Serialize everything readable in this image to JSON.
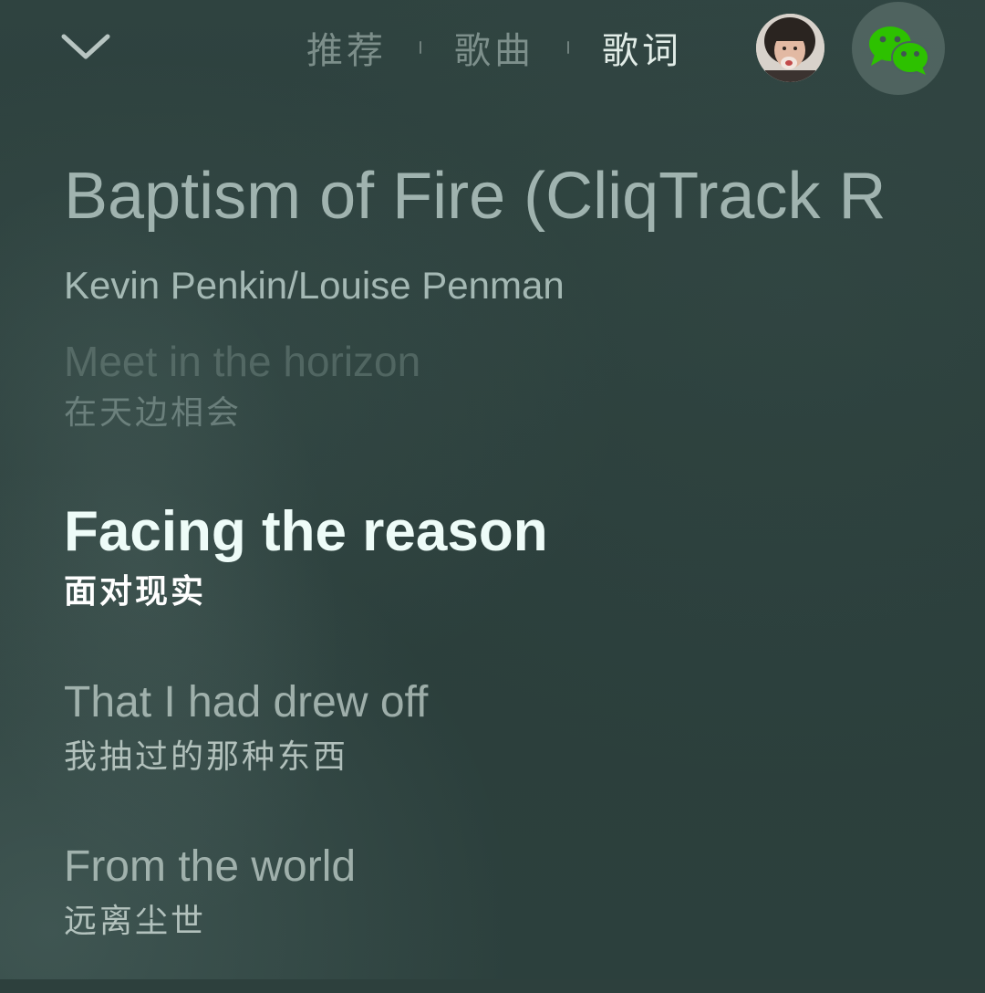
{
  "header": {
    "tabs": [
      {
        "label": "推荐",
        "active": false
      },
      {
        "label": "歌曲",
        "active": false
      },
      {
        "label": "歌词",
        "active": true
      }
    ],
    "back_icon": "chevron-down-icon",
    "share_icon": "wechat-icon",
    "share_color": "#2dc100"
  },
  "song": {
    "title": "Baptism of Fire (CliqTrack R",
    "artist": "Kevin Penkin/Louise Penman"
  },
  "lyrics": [
    {
      "en": "Meet in the horizon",
      "zh": "在天边相会",
      "state": "past"
    },
    {
      "en": "Facing the reason",
      "zh": "面对现实",
      "state": "current"
    },
    {
      "en": "That I had drew off",
      "zh": "我抽过的那种东西",
      "state": "upcoming"
    },
    {
      "en": "From the world",
      "zh": "远离尘世",
      "state": "upcoming"
    }
  ],
  "colors": {
    "background": "#2d403d",
    "current_lyric": "#eefcf8",
    "active_tab": "#ebf5f0"
  }
}
